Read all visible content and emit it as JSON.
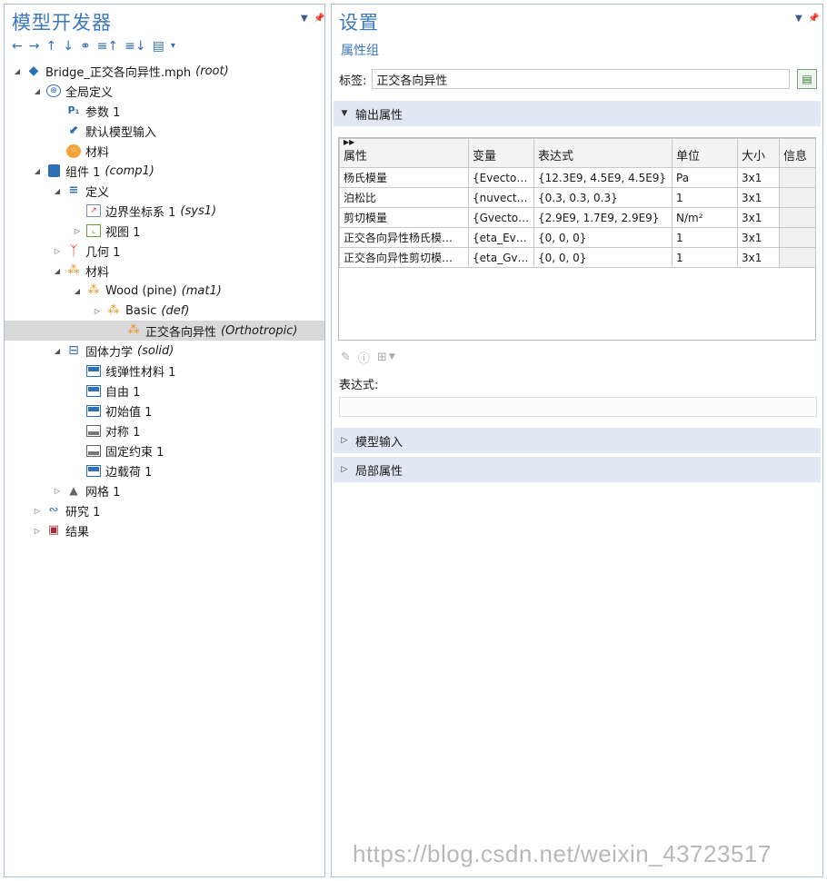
{
  "left_panel": {
    "title": "模型开发器",
    "toolbar": [
      "←",
      "→",
      "↑",
      "↓",
      "⚭",
      "≡↑",
      "≡↓",
      "▤",
      "▾"
    ]
  },
  "tree": [
    {
      "label": "Bridge_正交各向异性.mph",
      "tag": "(root)"
    },
    {
      "label": "全局定义",
      "tag": ""
    },
    {
      "label": "参数 1",
      "tag": ""
    },
    {
      "label": "默认模型输入",
      "tag": ""
    },
    {
      "label": "材料",
      "tag": ""
    },
    {
      "label": "组件 1",
      "tag": "(comp1)"
    },
    {
      "label": "定义",
      "tag": ""
    },
    {
      "label": "边界坐标系 1",
      "tag": "(sys1)"
    },
    {
      "label": "视图 1",
      "tag": ""
    },
    {
      "label": "几何 1",
      "tag": ""
    },
    {
      "label": "材料",
      "tag": ""
    },
    {
      "label": "Wood (pine)",
      "tag": "(mat1)"
    },
    {
      "label": "Basic",
      "tag": "(def)"
    },
    {
      "label": "正交各向异性",
      "tag": "(Orthotropic)"
    },
    {
      "label": "固体力学",
      "tag": "(solid)"
    },
    {
      "label": "线弹性材料 1",
      "tag": ""
    },
    {
      "label": "自由 1",
      "tag": ""
    },
    {
      "label": "初始值 1",
      "tag": ""
    },
    {
      "label": "对称 1",
      "tag": ""
    },
    {
      "label": "固定约束 1",
      "tag": ""
    },
    {
      "label": "边载荷 1",
      "tag": ""
    },
    {
      "label": "网格 1",
      "tag": ""
    },
    {
      "label": "研究 1",
      "tag": ""
    },
    {
      "label": "结果",
      "tag": ""
    }
  ],
  "right_panel": {
    "title": "设置",
    "subtitle": "属性组",
    "label_caption": "标签:",
    "label_value": "正交各向异性",
    "output_section": "输出属性",
    "expr_caption": "表达式:",
    "model_input_section": "模型输入",
    "local_props_section": "局部属性"
  },
  "table": {
    "headers": [
      "属性",
      "变量",
      "表达式",
      "单位",
      "大小",
      "信息"
    ],
    "rows": [
      [
        "杨氏模量",
        "{Evector…",
        "{12.3E9, 4.5E9, 4.5E9}",
        "Pa",
        "3x1",
        ""
      ],
      [
        "泊松比",
        "{nuvect…",
        "{0.3, 0.3, 0.3}",
        "1",
        "3x1",
        ""
      ],
      [
        "剪切模量",
        "{Gvecto…",
        "{2.9E9, 1.7E9, 2.9E9}",
        "N/m²",
        "3x1",
        ""
      ],
      [
        "正交各向异性杨氏模…",
        "{eta_Eve…",
        "{0, 0, 0}",
        "1",
        "3x1",
        ""
      ],
      [
        "正交各向异性剪切模…",
        "{eta_Gv…",
        "{0, 0, 0}",
        "1",
        "3x1",
        ""
      ]
    ]
  },
  "watermark": "https://blog.csdn.net/weixin_43723517"
}
